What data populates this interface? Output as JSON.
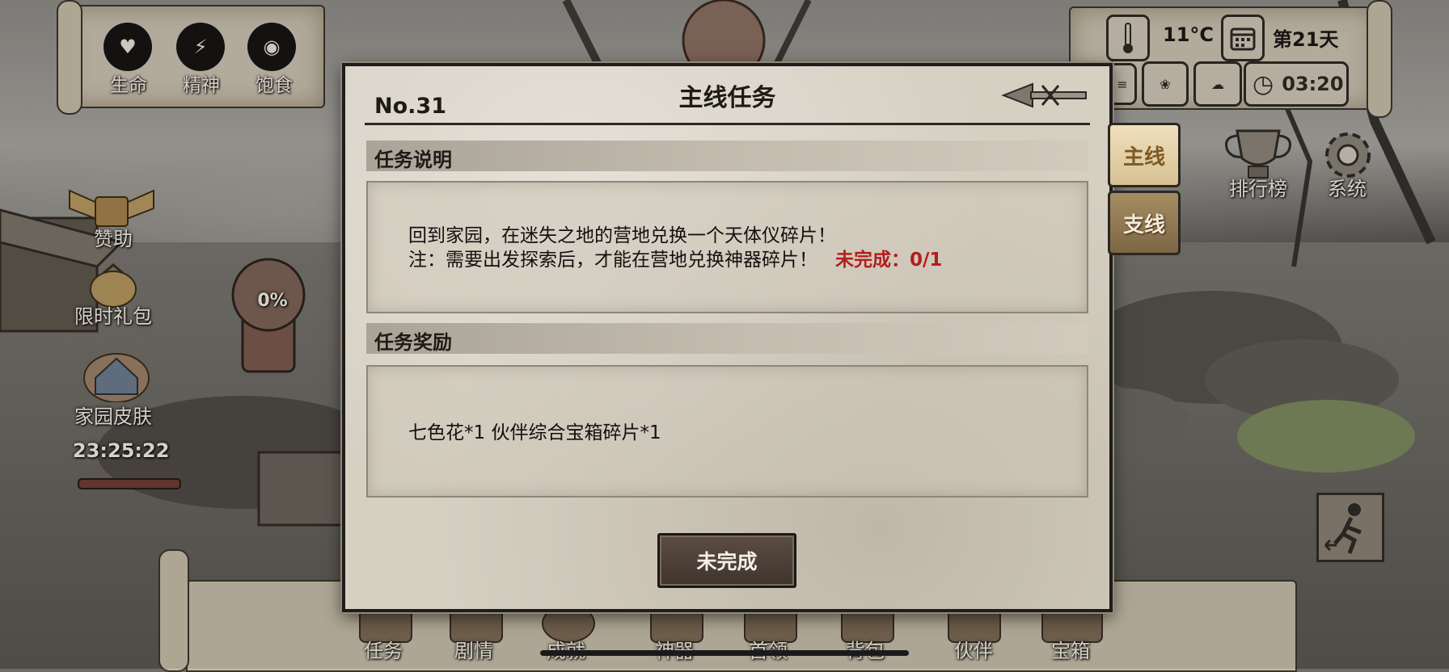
{
  "hud": {
    "stats": [
      {
        "icon": "heart-icon",
        "label": "生命"
      },
      {
        "icon": "lightning-icon",
        "label": "精神"
      },
      {
        "icon": "stomach-icon",
        "label": "饱食"
      }
    ],
    "temperature": "11°C",
    "day": "第21天",
    "time": "03:20"
  },
  "left_menu": {
    "sponsor": "赞助",
    "limited_pack": "限时礼包",
    "home_skin": "家园皮肤",
    "countdown": "23:25:22",
    "progress_percent": "0%"
  },
  "right_menu": {
    "leaderboard": "排行榜",
    "system": "系统"
  },
  "bottom_menu": {
    "items": [
      "任务",
      "剧情",
      "成就",
      "神器",
      "首领",
      "背包",
      "伙伴",
      "宝箱"
    ]
  },
  "dialog": {
    "title": "主线任务",
    "number": "No.31",
    "description_header": "任务说明",
    "description_line1": "回到家园，在迷失之地的营地兑换一个天体仪碎片！",
    "description_line2": "注：需要出发探索后，才能在营地兑换神器碎片！",
    "progress_status": "未完成：0/1",
    "reward_header": "任务奖励",
    "rewards": "七色花*1 伙伴综合宝箱碎片*1",
    "status_button": "未完成"
  },
  "tabs": {
    "main": "主线",
    "side": "支线"
  },
  "colors": {
    "incomplete_red": "#b21e1b",
    "parchment": "#d6d0c3",
    "button_dark": "#4b3f36"
  }
}
